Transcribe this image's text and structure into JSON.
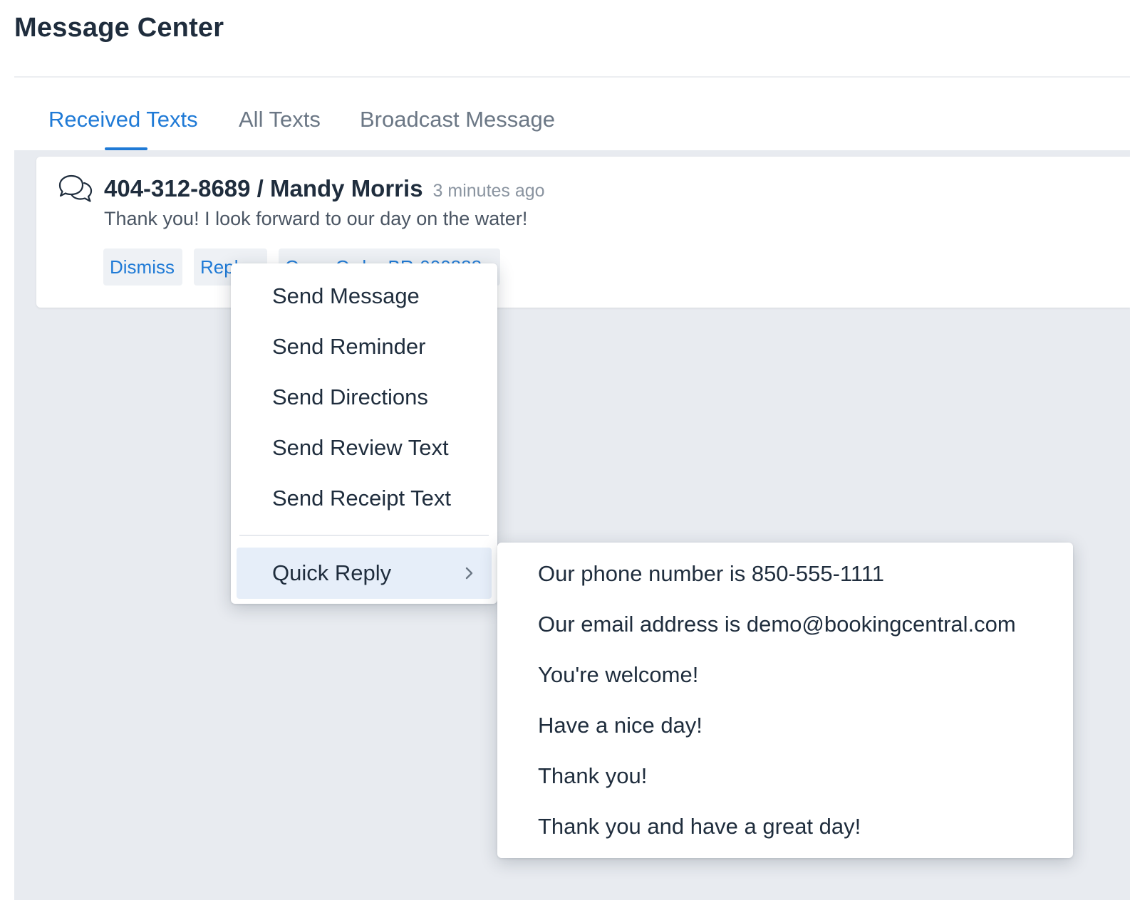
{
  "page": {
    "title": "Message Center"
  },
  "tabs": [
    {
      "label": "Received Texts",
      "active": true
    },
    {
      "label": "All Texts",
      "active": false
    },
    {
      "label": "Broadcast Message",
      "active": false
    }
  ],
  "message": {
    "icon": "chat-bubbles-icon",
    "sender": "404-312-8689 / Mandy Morris",
    "time": "3 minutes ago",
    "body": "Thank you! I look forward to our day on the water!",
    "actions": {
      "dismiss": "Dismiss",
      "reply": "Reply",
      "open_order": "Open Order BR-000888"
    }
  },
  "reply_menu": {
    "items": [
      "Send Message",
      "Send Reminder",
      "Send Directions",
      "Send Review Text",
      "Send Receipt Text"
    ],
    "quick_reply": {
      "label": "Quick Reply",
      "icon": "chevron-right-icon"
    }
  },
  "quick_reply_menu": {
    "items": [
      "Our phone number is 850-555-1111",
      "Our email address is demo@bookingcentral.com",
      "You're welcome!",
      "Have a nice day!",
      "Thank you!",
      "Thank you and have a great day!"
    ]
  },
  "colors": {
    "accent": "#1f7ad6",
    "text": "#1f2d3d",
    "muted": "#6b7785",
    "background": "#e8ebf0",
    "highlight": "#e6eef9"
  }
}
